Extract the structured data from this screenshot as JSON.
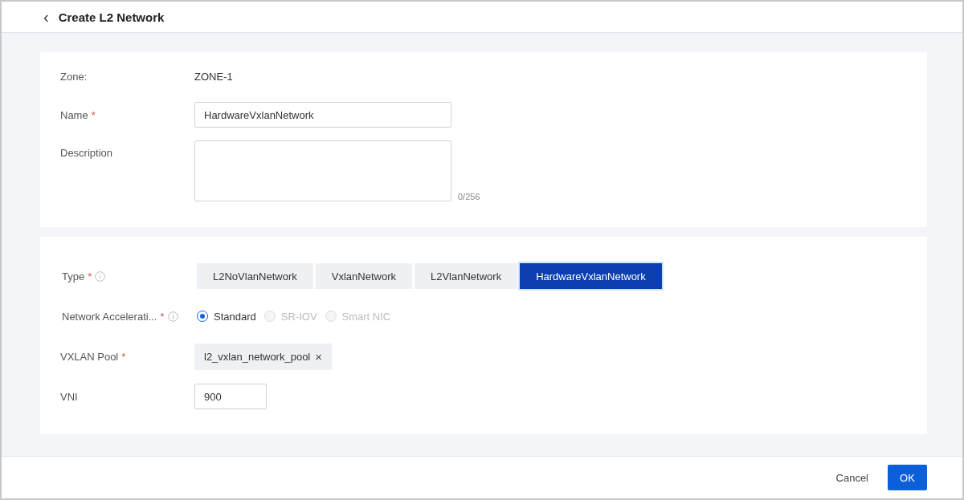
{
  "header": {
    "back_icon": "‹",
    "title": "Create L2 Network"
  },
  "basic": {
    "zone": {
      "label": "Zone:",
      "value": "ZONE-1"
    },
    "name": {
      "label": "Name",
      "required_mark": "*",
      "value": "HardwareVxlanNetwork"
    },
    "description": {
      "label": "Description",
      "counter": "0/256"
    }
  },
  "network": {
    "type": {
      "label": "Type",
      "required_mark": "*",
      "info": true,
      "options": [
        {
          "label": "L2NoVlanNetwork",
          "selected": false
        },
        {
          "label": "VxlanNetwork",
          "selected": false
        },
        {
          "label": "L2VlanNetwork",
          "selected": false
        },
        {
          "label": "HardwareVxlanNetwork",
          "selected": true
        }
      ]
    },
    "acceleration": {
      "label": "Network Accelerati...",
      "required_mark": "*",
      "info": true,
      "options": [
        {
          "label": "Standard",
          "selected": true,
          "disabled": false
        },
        {
          "label": "SR-IOV",
          "selected": false,
          "disabled": true
        },
        {
          "label": "Smart NIC",
          "selected": false,
          "disabled": true
        }
      ]
    },
    "vxlan_pool": {
      "label": "VXLAN Pool",
      "required_mark": "*",
      "tags": [
        {
          "label": "l2_vxlan_network_pool",
          "remove": "×"
        }
      ]
    },
    "vni": {
      "label": "VNI",
      "value": "900"
    }
  },
  "footer": {
    "buttons": [
      {
        "label": "Cancel",
        "kind": "text"
      },
      {
        "label": "OK",
        "kind": "primary"
      }
    ]
  }
}
